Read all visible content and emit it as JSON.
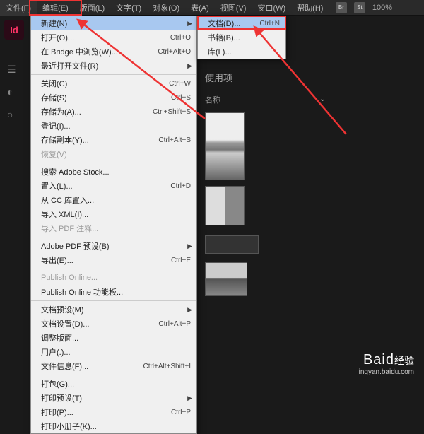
{
  "menubar": {
    "items": [
      "文件(F)",
      "编辑(E)",
      "版面(L)",
      "文字(T)",
      "对象(O)",
      "表(A)",
      "视图(V)",
      "窗口(W)",
      "帮助(H)"
    ],
    "icons": [
      "Br",
      "St"
    ],
    "zoom": "100%"
  },
  "app_icon": "Id",
  "file_menu": {
    "groups": [
      [
        {
          "label": "新建(N)",
          "shortcut": "",
          "sub": true,
          "hl": true
        },
        {
          "label": "打开(O)...",
          "shortcut": "Ctrl+O"
        },
        {
          "label": "在 Bridge 中浏览(W)...",
          "shortcut": "Ctrl+Alt+O"
        },
        {
          "label": "最近打开文件(R)",
          "shortcut": "",
          "sub": true
        }
      ],
      [
        {
          "label": "关闭(C)",
          "shortcut": "Ctrl+W"
        },
        {
          "label": "存储(S)",
          "shortcut": "Ctrl+S"
        },
        {
          "label": "存储为(A)...",
          "shortcut": "Ctrl+Shift+S"
        },
        {
          "label": "登记(I)...",
          "shortcut": ""
        },
        {
          "label": "存储副本(Y)...",
          "shortcut": "Ctrl+Alt+S"
        },
        {
          "label": "恢复(V)",
          "shortcut": "",
          "dim": true
        }
      ],
      [
        {
          "label": "搜索 Adobe Stock...",
          "shortcut": ""
        },
        {
          "label": "置入(L)...",
          "shortcut": "Ctrl+D"
        },
        {
          "label": "从 CC 库置入...",
          "shortcut": ""
        },
        {
          "label": "导入 XML(I)...",
          "shortcut": ""
        },
        {
          "label": "导入 PDF 注释...",
          "shortcut": "",
          "dim": true
        }
      ],
      [
        {
          "label": "Adobe PDF 预设(B)",
          "shortcut": "",
          "sub": true
        },
        {
          "label": "导出(E)...",
          "shortcut": "Ctrl+E"
        }
      ],
      [
        {
          "label": "Publish Online...",
          "shortcut": "",
          "dim": true
        },
        {
          "label": "Publish Online 功能板...",
          "shortcut": ""
        }
      ],
      [
        {
          "label": "文档预设(M)",
          "shortcut": "",
          "sub": true
        },
        {
          "label": "文档设置(D)...",
          "shortcut": "Ctrl+Alt+P"
        },
        {
          "label": "调整版面...",
          "shortcut": ""
        },
        {
          "label": "用户(.)...",
          "shortcut": ""
        },
        {
          "label": "文件信息(F)...",
          "shortcut": "Ctrl+Alt+Shift+I"
        }
      ],
      [
        {
          "label": "打包(G)...",
          "shortcut": ""
        },
        {
          "label": "打印预设(T)",
          "shortcut": "",
          "sub": true
        },
        {
          "label": "打印(P)...",
          "shortcut": "Ctrl+P"
        },
        {
          "label": "打印小册子(K)...",
          "shortcut": ""
        }
      ]
    ]
  },
  "submenu": {
    "items": [
      {
        "label": "文档(D)...",
        "shortcut": "Ctrl+N",
        "hl": true
      },
      {
        "label": "书籍(B)...",
        "shortcut": ""
      },
      {
        "label": "库(L)...",
        "shortcut": ""
      }
    ]
  },
  "content": {
    "section": "使用项",
    "col_name": "名称"
  },
  "watermark": {
    "brand": "Baid",
    "suffix": "经验",
    "url": "jingyan.baidu.com"
  }
}
